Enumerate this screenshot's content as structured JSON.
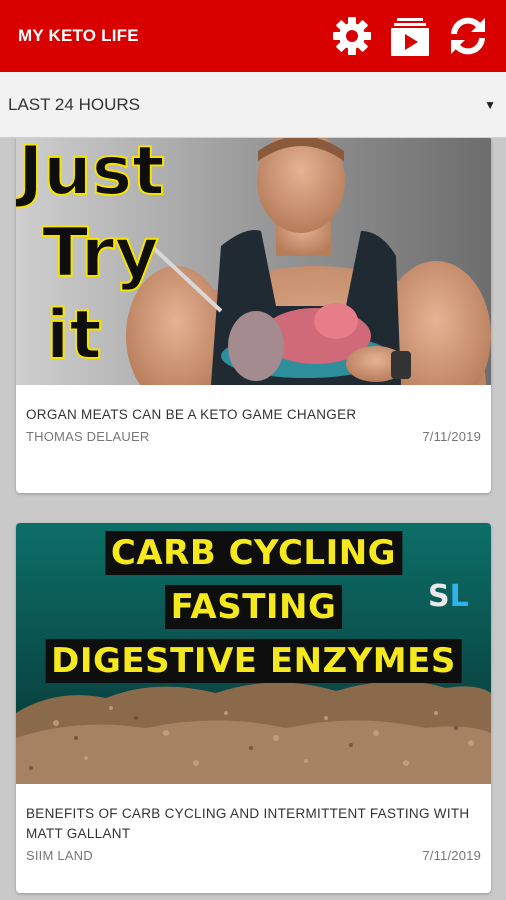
{
  "app": {
    "title": "MY KETO LIFE",
    "brand_color": "#d90000",
    "icons": [
      "gear-icon",
      "playlist-icon",
      "refresh-icon"
    ]
  },
  "filter": {
    "selected": "LAST 24 HOURS"
  },
  "videos": [
    {
      "title": "ORGAN MEATS CAN BE A KETO GAME CHANGER",
      "channel": "THOMAS DELAUER",
      "date": "7/11/2019",
      "thumbnail_text": [
        "Just",
        "Try",
        "it"
      ]
    },
    {
      "title": "BENEFITS OF CARB CYCLING AND INTERMITTENT FASTING WITH MATT GALLANT",
      "channel": "SIIM LAND",
      "date": "7/11/2019",
      "thumbnail_text": [
        "CARB CYCLING",
        "FASTING",
        "DIGESTIVE ENZYMES"
      ],
      "thumbnail_logo": [
        "S",
        "L"
      ]
    }
  ]
}
